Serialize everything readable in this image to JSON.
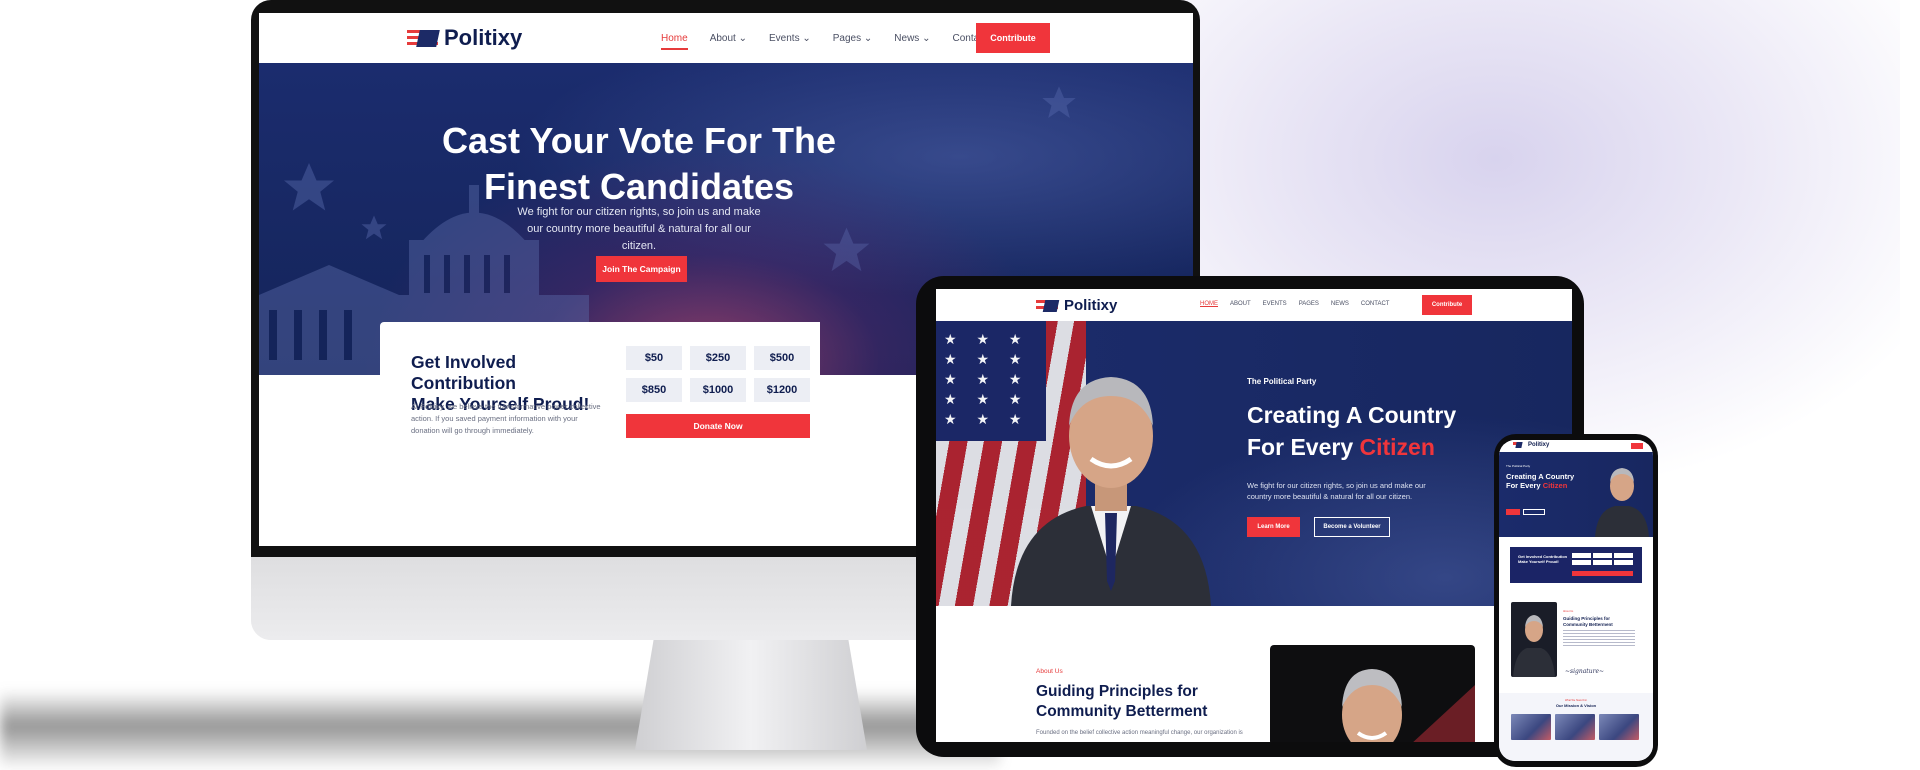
{
  "brand": {
    "name": "Politixy"
  },
  "desktop": {
    "nav": {
      "items": [
        {
          "label": "Home",
          "active": true
        },
        {
          "label": "About",
          "dropdown": true
        },
        {
          "label": "Events",
          "dropdown": true
        },
        {
          "label": "Pages",
          "dropdown": true
        },
        {
          "label": "News",
          "dropdown": true
        },
        {
          "label": "Contact"
        }
      ],
      "cta": "Contribute"
    },
    "hero": {
      "title_line1": "Cast Your Vote For The",
      "title_line2": "Finest Candidates",
      "description": "We fight for our citizen rights, so join us and make our country more beautiful & natural for all our citizen.",
      "button": "Join The Campaign"
    },
    "contribution": {
      "title_line1": "Get Involved Contribution",
      "title_line2": "Make Yourself Proud!",
      "description": "At Politixy, we believe the transformative power collective action. If you saved payment information with your donation will go through immediately.",
      "amounts": [
        "$50",
        "$250",
        "$500",
        "$850",
        "$1000",
        "$1200"
      ],
      "donate": "Donate Now"
    }
  },
  "tablet": {
    "nav": {
      "items": [
        "HOME",
        "ABOUT",
        "EVENTS",
        "PAGES",
        "NEWS",
        "CONTACT"
      ],
      "cta": "Contribute"
    },
    "hero": {
      "kicker": "The Political Party",
      "title_line1": "Creating A Country",
      "title_line2_prefix": "For Every ",
      "title_highlight": "Citizen",
      "description": "We fight for our citizen rights, so join us and make our country more beautiful & natural for all our citizen.",
      "learn_more": "Learn More",
      "volunteer": "Become a Volunteer"
    },
    "about": {
      "kicker": "About Us",
      "title_line1": "Guiding Principles for",
      "title_line2": "Community Betterment",
      "text": "Founded on the belief collective action meaningful change, our organization is"
    }
  },
  "phone": {
    "hero": {
      "kicker": "The Political Party",
      "title_line1": "Creating A Country",
      "title_line2_prefix": "For Every ",
      "title_highlight": "Citizen"
    },
    "contribution": {
      "title": "Get Involved Contribution Make Yourself Proud!"
    },
    "about": {
      "kicker": "About Us",
      "title": "Guiding Principles for Community Betterment"
    },
    "mission": {
      "kicker": "What We Stand For",
      "title": "Our Mission & Vision"
    }
  },
  "colors": {
    "accent_red": "#f0353b",
    "navy": "#0f1d4f",
    "hero_blue": "#1b2c6e"
  },
  "icons": [
    "flag-logo-icon",
    "chevron-down-icon",
    "star-icon",
    "capitol-dome-icon"
  ]
}
